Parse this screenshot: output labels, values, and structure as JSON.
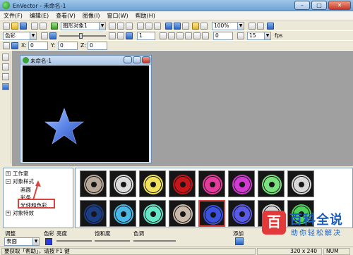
{
  "window": {
    "title": "EnVector - 未命名-1",
    "minimize": "–",
    "maximize": "□",
    "close": "✕"
  },
  "menu": [
    "文件(F)",
    "编辑(E)",
    "查看(V)",
    "图像(I)",
    "窗口(W)",
    "帮助(H)"
  ],
  "toolbar1": {
    "object_combo": "图形对象1",
    "zoom_combo": "100%"
  },
  "toolbar2": {
    "effect_combo": "色彩",
    "frame_field": "1",
    "frames_field": "15",
    "fps_label": "fps"
  },
  "toolbar3": {
    "x_label": "X:",
    "x_value": "0",
    "y_label": "Y:",
    "y_value": "0",
    "z_label": "Z:",
    "z_value": "0"
  },
  "child_window": {
    "title": "未命名-1"
  },
  "colors": {
    "star": "#5b86e8",
    "selection": "#d9433b",
    "watermark": "#1b5fbf"
  },
  "tree": {
    "root": "工作室",
    "group": "对象样式",
    "items": [
      "画面",
      "彩条",
      "光线和色彩"
    ],
    "last": "对象特效"
  },
  "gallery": {
    "row1": [
      "#b8a899",
      "#dcdcdc",
      "#f2e25a",
      "#c8151b",
      "#e43b9c",
      "#d23ad1",
      "#7ae07d",
      "#d8d8d8"
    ],
    "row2": [
      "#1a3d84",
      "#48b8e8",
      "#65e6c7",
      "#c9b9aa",
      "#3b52e0",
      "#5a5ae8",
      "#d7d7d7",
      "#4ed15a"
    ],
    "selected_index": 12
  },
  "props": {
    "adjust_label": "调整",
    "adjust_value": "表面",
    "color_label": "色彩",
    "brightness_label": "亮度",
    "saturation_label": "饱和度",
    "hue_label": "色调",
    "add_label": "添加"
  },
  "status": {
    "left": "要获取「帮助」，请按 F1 键",
    "size": "320 x 240",
    "num": "NUM"
  },
  "watermark": {
    "icon": "百",
    "title": "百科全说",
    "subtitle": "助你轻松解决"
  }
}
